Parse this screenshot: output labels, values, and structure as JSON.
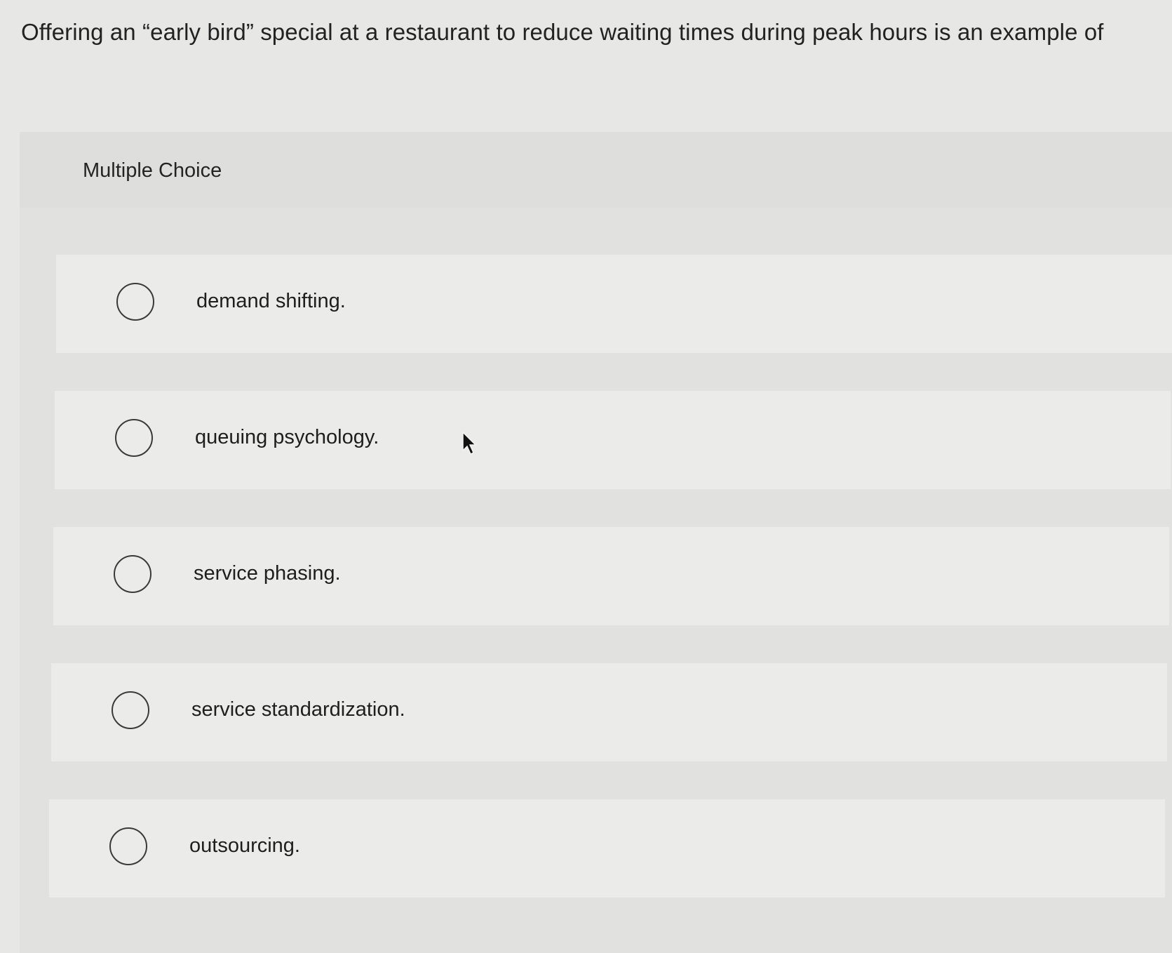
{
  "question": {
    "text": "Offering an “early bird” special at a restaurant to reduce waiting times during peak hours is an example of"
  },
  "panel": {
    "type_label": "Multiple Choice",
    "options": [
      {
        "label": "demand shifting."
      },
      {
        "label": "queuing psychology."
      },
      {
        "label": "service phasing."
      },
      {
        "label": "service standardization."
      },
      {
        "label": "outsourcing."
      }
    ]
  },
  "icons": {
    "radio": "radio-unselected-icon",
    "cursor": "mouse-pointer-icon"
  }
}
